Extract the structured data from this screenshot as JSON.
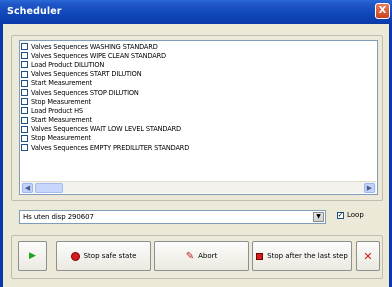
{
  "window": {
    "title": "Scheduler",
    "close_glyph": "X"
  },
  "steps": [
    {
      "label": "Valves Sequences WASHING STANDARD",
      "checked": false
    },
    {
      "label": "Valves Sequences WIPE CLEAN STANDARD",
      "checked": false
    },
    {
      "label": "Load Product DILUTION",
      "checked": false
    },
    {
      "label": "Valves Sequences START DILUTION",
      "checked": false
    },
    {
      "label": "Start Measurement",
      "checked": false
    },
    {
      "label": "Valves Sequences STOP DILUTION",
      "checked": false
    },
    {
      "label": "Stop Measurement",
      "checked": false
    },
    {
      "label": "Load Product HS",
      "checked": false
    },
    {
      "label": "Start Measurement",
      "checked": false
    },
    {
      "label": "Valves Sequences WAIT LOW LEVEL STANDARD",
      "checked": false
    },
    {
      "label": "Stop Measurement",
      "checked": false
    },
    {
      "label": "Valves Sequences EMPTY PREDILUTER STANDARD",
      "checked": false
    }
  ],
  "sequence": {
    "selected": "Hs uten disp 290607",
    "loop_label": "Loop",
    "loop_checked": true
  },
  "buttons": {
    "play_icon": "play-icon",
    "stop_safe_label": "Stop safe state",
    "abort_label": "Abort",
    "stop_after_label": "Stop after the last step",
    "cancel_icon": "cancel-icon"
  },
  "colors": {
    "titlebar": "#0a3aa8",
    "play": "#19a51e",
    "stop": "#d61d1d"
  }
}
